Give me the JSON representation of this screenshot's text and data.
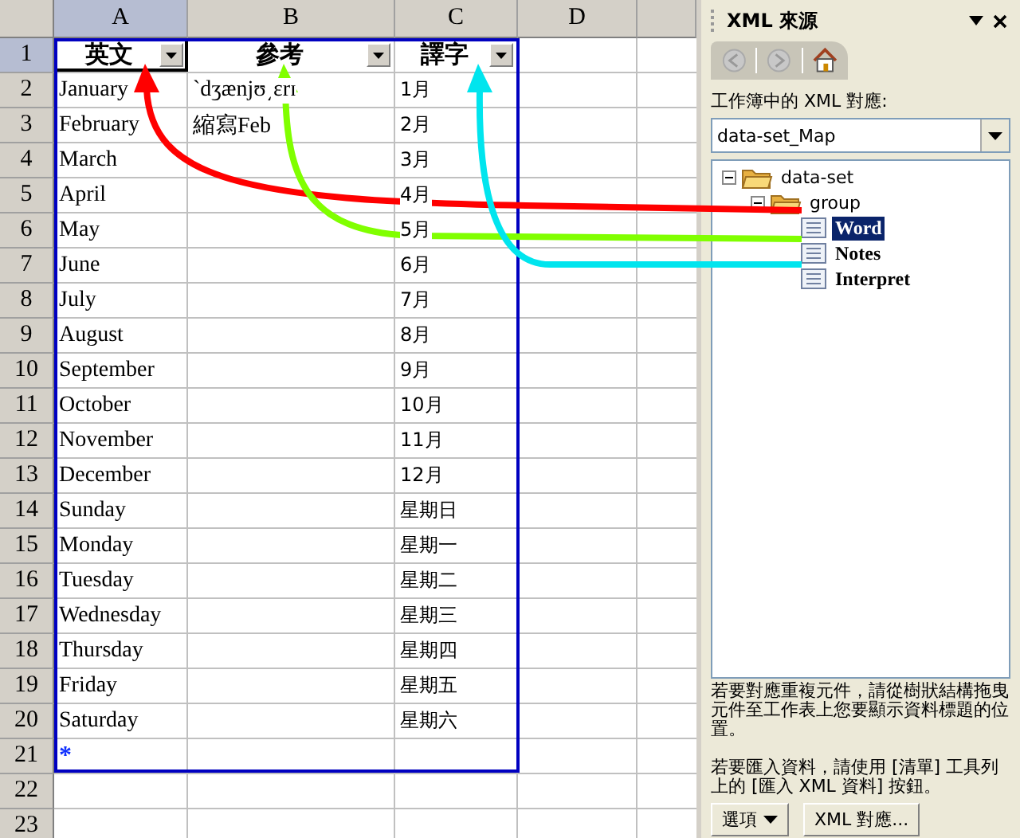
{
  "sheet": {
    "columns": [
      {
        "label": "A",
        "selected": true
      },
      {
        "label": "B",
        "selected": false
      },
      {
        "label": "C",
        "selected": false
      },
      {
        "label": "D",
        "selected": false
      }
    ],
    "rows": [
      {
        "label": "1",
        "selected": true,
        "kind": "header",
        "cells": [
          "英文",
          "參考",
          "譯字"
        ]
      },
      {
        "label": "2",
        "selected": false,
        "kind": "data",
        "cells": [
          "January",
          "ˋdʒænjʊ͵ɛrɪ",
          "1月"
        ]
      },
      {
        "label": "3",
        "selected": false,
        "kind": "data",
        "cells": [
          "February",
          "縮寫Feb",
          "2月"
        ]
      },
      {
        "label": "4",
        "selected": false,
        "kind": "data",
        "cells": [
          "March",
          "",
          "3月"
        ]
      },
      {
        "label": "5",
        "selected": false,
        "kind": "data",
        "cells": [
          "April",
          "",
          "4月"
        ]
      },
      {
        "label": "6",
        "selected": false,
        "kind": "data",
        "cells": [
          "May",
          "",
          "5月"
        ]
      },
      {
        "label": "7",
        "selected": false,
        "kind": "data",
        "cells": [
          "June",
          "",
          "6月"
        ]
      },
      {
        "label": "8",
        "selected": false,
        "kind": "data",
        "cells": [
          "July",
          "",
          "7月"
        ]
      },
      {
        "label": "9",
        "selected": false,
        "kind": "data",
        "cells": [
          "August",
          "",
          "8月"
        ]
      },
      {
        "label": "10",
        "selected": false,
        "kind": "data",
        "cells": [
          "September",
          "",
          "9月"
        ]
      },
      {
        "label": "11",
        "selected": false,
        "kind": "data",
        "cells": [
          "October",
          "",
          "10月"
        ]
      },
      {
        "label": "12",
        "selected": false,
        "kind": "data",
        "cells": [
          "November",
          "",
          "11月"
        ]
      },
      {
        "label": "13",
        "selected": false,
        "kind": "data",
        "cells": [
          "December",
          "",
          "12月"
        ]
      },
      {
        "label": "14",
        "selected": false,
        "kind": "data",
        "cells": [
          "Sunday",
          "",
          "星期日"
        ]
      },
      {
        "label": "15",
        "selected": false,
        "kind": "data",
        "cells": [
          "Monday",
          "",
          "星期一"
        ]
      },
      {
        "label": "16",
        "selected": false,
        "kind": "data",
        "cells": [
          "Tuesday",
          "",
          "星期二"
        ]
      },
      {
        "label": "17",
        "selected": false,
        "kind": "data",
        "cells": [
          "Wednesday",
          "",
          "星期三"
        ]
      },
      {
        "label": "18",
        "selected": false,
        "kind": "data",
        "cells": [
          "Thursday",
          "",
          "星期四"
        ]
      },
      {
        "label": "19",
        "selected": false,
        "kind": "data",
        "cells": [
          "Friday",
          "",
          "星期五"
        ]
      },
      {
        "label": "20",
        "selected": false,
        "kind": "data",
        "cells": [
          "Saturday",
          "",
          "星期六"
        ]
      },
      {
        "label": "21",
        "selected": false,
        "kind": "insert",
        "cells": [
          "*",
          "",
          ""
        ]
      },
      {
        "label": "22",
        "selected": false,
        "kind": "empty",
        "cells": [
          "",
          "",
          ""
        ]
      },
      {
        "label": "23",
        "selected": false,
        "kind": "empty",
        "cells": [
          "",
          "",
          ""
        ]
      }
    ]
  },
  "mappings": [
    {
      "color": "#ff0000"
    },
    {
      "color": "#80ff00"
    },
    {
      "color": "#00e5ee"
    }
  ],
  "panel": {
    "title": "XML 來源",
    "maps_label": "工作簿中的 XML 對應:",
    "map_select": {
      "value": "data-set_Map"
    },
    "tree": [
      {
        "label": "data-set",
        "expanded": true,
        "children": [
          {
            "label": "group",
            "expanded": true,
            "children": [
              {
                "label": "Word",
                "selected": true
              },
              {
                "label": "Notes",
                "selected": false
              },
              {
                "label": "Interpret",
                "selected": false
              }
            ]
          }
        ]
      }
    ],
    "hint_repeat": "若要對應重複元件，請從樹狀結構拖曳元件至工作表上您要顯示資料標題的位置。",
    "hint_import": "若要匯入資料，請使用 [清單] 工具列上的 [匯入 XML 資料] 按鈕。",
    "buttons": [
      {
        "label": "選項",
        "kind": "menu"
      },
      {
        "label": "XML 對應...",
        "kind": "plain"
      }
    ]
  }
}
